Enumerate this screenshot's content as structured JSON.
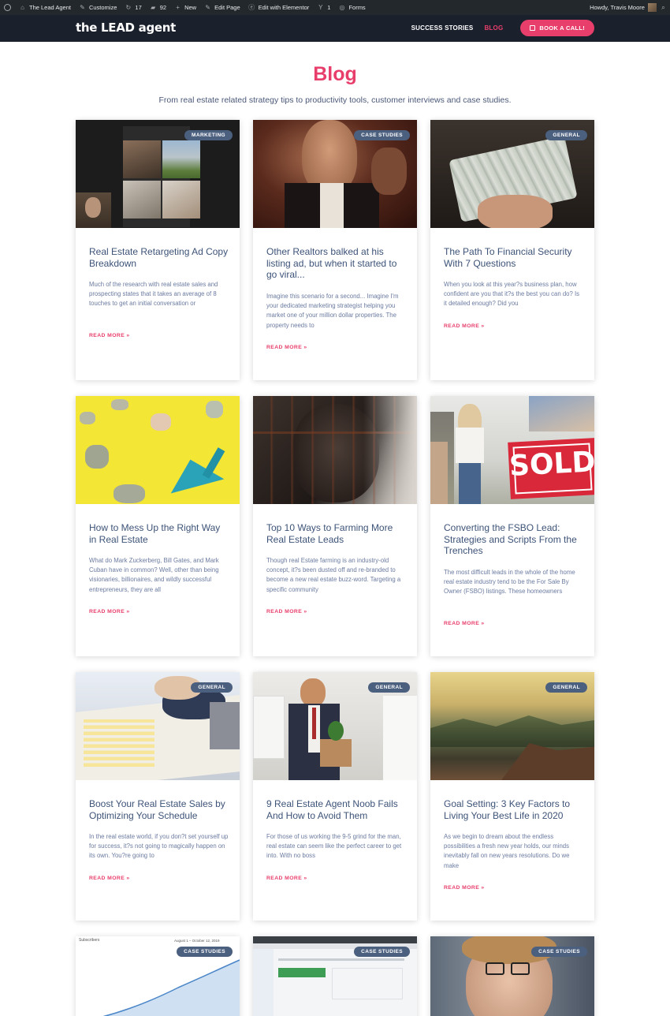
{
  "adminbar": {
    "site_name": "The Lead Agent",
    "customize": "Customize",
    "updates": "17",
    "comments": "92",
    "new": "New",
    "edit_page": "Edit Page",
    "elementor": "Edit with Elementor",
    "yoast_count": "1",
    "forms": "Forms",
    "howdy": "Howdy, Travis Moore"
  },
  "header": {
    "logo": "the LEAD agent",
    "nav": [
      "SUCCESS STORIES",
      "BLOG"
    ],
    "cta": "BOOK A CALL!"
  },
  "page": {
    "title": "Blog",
    "subtitle": "From real estate related strategy tips to productivity tools, customer interviews and case studies."
  },
  "read_more": "READ MORE »",
  "posts": [
    {
      "badge": "MARKETING",
      "title": "Real Estate Retargeting Ad Copy Breakdown",
      "excerpt": "Much of the research with real estate sales and prospecting states that it takes an average of 8 touches to get an initial conversation or",
      "read_more": "READ MORE »"
    },
    {
      "badge": "CASE STUDIES",
      "title": "Other Realtors balked at his listing ad, but when it started to go viral...",
      "excerpt": "Imagine this scenario for a second... Imagine I'm your dedicated marketing strategist helping you market one of your million dollar properties. The property needs to",
      "read_more": "READ MORE »"
    },
    {
      "badge": "GENERAL",
      "title": "The Path To Financial Security With 7 Questions",
      "excerpt": "When you look at this year?s business plan, how confident are you that it?s the best you can do? Is it detailed enough? Did you",
      "read_more": "READ MORE »"
    },
    {
      "badge": "",
      "title": "How to Mess Up the Right Way in Real Estate",
      "excerpt": "What do Mark Zuckerberg, Bill Gates, and Mark Cuban have in common? Well, other than being visionaries, billionaires, and wildly successful entrepreneurs, they are all",
      "read_more": "READ MORE »"
    },
    {
      "badge": "",
      "title": "Top 10 Ways to Farming More Real Estate Leads",
      "excerpt": "Though real Estate farming is an industry-old concept, it?s been dusted off and re-branded to become a new real estate buzz-word. Targeting a specific community",
      "read_more": "READ MORE »"
    },
    {
      "badge": "",
      "title": "Converting the FSBO Lead: Strategies and Scripts From the Trenches",
      "excerpt": "The most difficult leads in the whole of the home real estate industry tend to be the For Sale By Owner (FSBO) listings. These homeowners",
      "read_more": "READ MORE »",
      "sold_sign": "SOLD"
    },
    {
      "badge": "GENERAL",
      "title": "Boost Your Real Estate Sales by Optimizing Your Schedule",
      "excerpt": "In the real estate world, if you don?t set yourself up for success, it?s not going to magically happen on its own. You?re going to",
      "read_more": "READ MORE »"
    },
    {
      "badge": "GENERAL",
      "title": "9 Real Estate Agent Noob Fails And How to Avoid Them",
      "excerpt": "For those of us working the 9-5 grind for the man, real estate can seem like the perfect career to get into. With no boss",
      "read_more": "READ MORE »"
    },
    {
      "badge": "GENERAL",
      "title": "Goal Setting: 3 Key Factors to Living Your Best Life in 2020",
      "excerpt": "As we begin to dream about the endless possibilities a fresh new year holds, our minds inevitably fall on new years resolutions. Do we make",
      "read_more": "READ MORE »"
    },
    {
      "badge": "CASE STUDIES",
      "chart_label": "Subscribers",
      "chart_range": "August 1 – October 12, 2019"
    },
    {
      "badge": "CASE STUDIES"
    },
    {
      "badge": "CASE STUDIES"
    }
  ]
}
